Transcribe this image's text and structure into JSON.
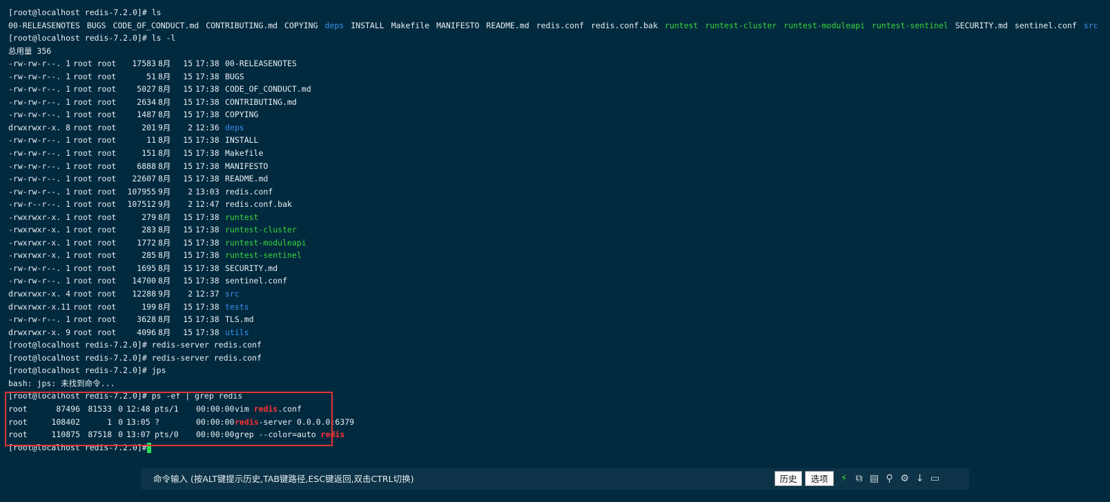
{
  "prompt": "[root@localhost redis-7.2.0]#",
  "commands": {
    "ls": "ls",
    "ls_l": "ls -l",
    "redis_server": "redis-server redis.conf",
    "jps": "jps",
    "ps": "ps -ef | grep redis"
  },
  "ls_output": [
    {
      "text": "00-RELEASENOTES",
      "color": "plain"
    },
    {
      "text": "BUGS",
      "color": "plain"
    },
    {
      "text": "CODE_OF_CONDUCT.md",
      "color": "plain"
    },
    {
      "text": "CONTRIBUTING.md",
      "color": "plain"
    },
    {
      "text": "COPYING",
      "color": "plain"
    },
    {
      "text": "deps",
      "color": "blue"
    },
    {
      "text": "INSTALL",
      "color": "plain"
    },
    {
      "text": "Makefile",
      "color": "plain"
    },
    {
      "text": "MANIFESTO",
      "color": "plain"
    },
    {
      "text": "README.md",
      "color": "plain"
    },
    {
      "text": "redis.conf",
      "color": "plain"
    },
    {
      "text": "redis.conf.bak",
      "color": "plain"
    },
    {
      "text": "runtest",
      "color": "green"
    },
    {
      "text": "runtest-cluster",
      "color": "green"
    },
    {
      "text": "runtest-moduleapi",
      "color": "green"
    },
    {
      "text": "runtest-sentinel",
      "color": "green"
    },
    {
      "text": "SECURITY.md",
      "color": "plain"
    },
    {
      "text": "sentinel.conf",
      "color": "plain"
    },
    {
      "text": "src",
      "color": "blue"
    },
    {
      "text": "tests",
      "color": "blue"
    },
    {
      "text": "TLS.md",
      "color": "plain"
    },
    {
      "text": "utils",
      "color": "blue"
    }
  ],
  "total_line": "总用量 356",
  "ls_l_rows": [
    {
      "perm": "-rw-rw-r--.",
      "links": "1",
      "user": "root root",
      "size": "17583",
      "month": "8月",
      "day": "15",
      "time": "17:38",
      "name": "00-RELEASENOTES",
      "color": "plain"
    },
    {
      "perm": "-rw-rw-r--.",
      "links": "1",
      "user": "root root",
      "size": "51",
      "month": "8月",
      "day": "15",
      "time": "17:38",
      "name": "BUGS",
      "color": "plain"
    },
    {
      "perm": "-rw-rw-r--.",
      "links": "1",
      "user": "root root",
      "size": "5027",
      "month": "8月",
      "day": "15",
      "time": "17:38",
      "name": "CODE_OF_CONDUCT.md",
      "color": "plain"
    },
    {
      "perm": "-rw-rw-r--.",
      "links": "1",
      "user": "root root",
      "size": "2634",
      "month": "8月",
      "day": "15",
      "time": "17:38",
      "name": "CONTRIBUTING.md",
      "color": "plain"
    },
    {
      "perm": "-rw-rw-r--.",
      "links": "1",
      "user": "root root",
      "size": "1487",
      "month": "8月",
      "day": "15",
      "time": "17:38",
      "name": "COPYING",
      "color": "plain"
    },
    {
      "perm": "drwxrwxr-x.",
      "links": "8",
      "user": "root root",
      "size": "201",
      "month": "9月",
      "day": "2",
      "time": "12:36",
      "name": "deps",
      "color": "blue"
    },
    {
      "perm": "-rw-rw-r--.",
      "links": "1",
      "user": "root root",
      "size": "11",
      "month": "8月",
      "day": "15",
      "time": "17:38",
      "name": "INSTALL",
      "color": "plain"
    },
    {
      "perm": "-rw-rw-r--.",
      "links": "1",
      "user": "root root",
      "size": "151",
      "month": "8月",
      "day": "15",
      "time": "17:38",
      "name": "Makefile",
      "color": "plain"
    },
    {
      "perm": "-rw-rw-r--.",
      "links": "1",
      "user": "root root",
      "size": "6888",
      "month": "8月",
      "day": "15",
      "time": "17:38",
      "name": "MANIFESTO",
      "color": "plain"
    },
    {
      "perm": "-rw-rw-r--.",
      "links": "1",
      "user": "root root",
      "size": "22607",
      "month": "8月",
      "day": "15",
      "time": "17:38",
      "name": "README.md",
      "color": "plain"
    },
    {
      "perm": "-rw-rw-r--.",
      "links": "1",
      "user": "root root",
      "size": "107955",
      "month": "9月",
      "day": "2",
      "time": "13:03",
      "name": "redis.conf",
      "color": "plain"
    },
    {
      "perm": "-rw-r--r--.",
      "links": "1",
      "user": "root root",
      "size": "107512",
      "month": "9月",
      "day": "2",
      "time": "12:47",
      "name": "redis.conf.bak",
      "color": "plain"
    },
    {
      "perm": "-rwxrwxr-x.",
      "links": "1",
      "user": "root root",
      "size": "279",
      "month": "8月",
      "day": "15",
      "time": "17:38",
      "name": "runtest",
      "color": "green"
    },
    {
      "perm": "-rwxrwxr-x.",
      "links": "1",
      "user": "root root",
      "size": "283",
      "month": "8月",
      "day": "15",
      "time": "17:38",
      "name": "runtest-cluster",
      "color": "green"
    },
    {
      "perm": "-rwxrwxr-x.",
      "links": "1",
      "user": "root root",
      "size": "1772",
      "month": "8月",
      "day": "15",
      "time": "17:38",
      "name": "runtest-moduleapi",
      "color": "green"
    },
    {
      "perm": "-rwxrwxr-x.",
      "links": "1",
      "user": "root root",
      "size": "285",
      "month": "8月",
      "day": "15",
      "time": "17:38",
      "name": "runtest-sentinel",
      "color": "green"
    },
    {
      "perm": "-rw-rw-r--.",
      "links": "1",
      "user": "root root",
      "size": "1695",
      "month": "8月",
      "day": "15",
      "time": "17:38",
      "name": "SECURITY.md",
      "color": "plain"
    },
    {
      "perm": "-rw-rw-r--.",
      "links": "1",
      "user": "root root",
      "size": "14700",
      "month": "8月",
      "day": "15",
      "time": "17:38",
      "name": "sentinel.conf",
      "color": "plain"
    },
    {
      "perm": "drwxrwxr-x.",
      "links": "4",
      "user": "root root",
      "size": "12288",
      "month": "9月",
      "day": "2",
      "time": "12:37",
      "name": "src",
      "color": "blue"
    },
    {
      "perm": "drwxrwxr-x.",
      "links": "11",
      "user": "root root",
      "size": "199",
      "month": "8月",
      "day": "15",
      "time": "17:38",
      "name": "tests",
      "color": "blue"
    },
    {
      "perm": "-rw-rw-r--.",
      "links": "1",
      "user": "root root",
      "size": "3628",
      "month": "8月",
      "day": "15",
      "time": "17:38",
      "name": "TLS.md",
      "color": "plain"
    },
    {
      "perm": "drwxrwxr-x.",
      "links": "9",
      "user": "root root",
      "size": "4096",
      "month": "8月",
      "day": "15",
      "time": "17:38",
      "name": "utils",
      "color": "blue"
    }
  ],
  "jps_error": "bash: jps: 未找到命令...",
  "ps_rows": [
    {
      "user": "root",
      "pid": "87496",
      "ppid": "81533",
      "c": "0",
      "stime": "12:48",
      "tty": "pts/1",
      "time": "00:00:00",
      "cmd_pre": "vim ",
      "match": "redis",
      "cmd_post": ".conf"
    },
    {
      "user": "root",
      "pid": "108402",
      "ppid": "1",
      "c": "0",
      "stime": "13:05",
      "tty": "?",
      "time": "00:00:00",
      "cmd_pre": "",
      "match": "redis",
      "cmd_post": "-server 0.0.0.0:6379"
    },
    {
      "user": "root",
      "pid": "110875",
      "ppid": "87518",
      "c": "0",
      "stime": "13:07",
      "tty": "pts/0",
      "time": "00:00:00",
      "cmd_pre": "grep --color=auto ",
      "match": "redis",
      "cmd_post": ""
    }
  ],
  "cmdbar": {
    "hint": "命令输入 (按ALT键提示历史,TAB键路径,ESC键返回,双击CTRL切换)",
    "history_label": "历史",
    "options_label": "选项"
  },
  "colors": {
    "background": "#022a3f",
    "dir": "#3a8ff0",
    "exec": "#39d639",
    "match": "#ff3030",
    "highlight_box": "#e03434"
  }
}
